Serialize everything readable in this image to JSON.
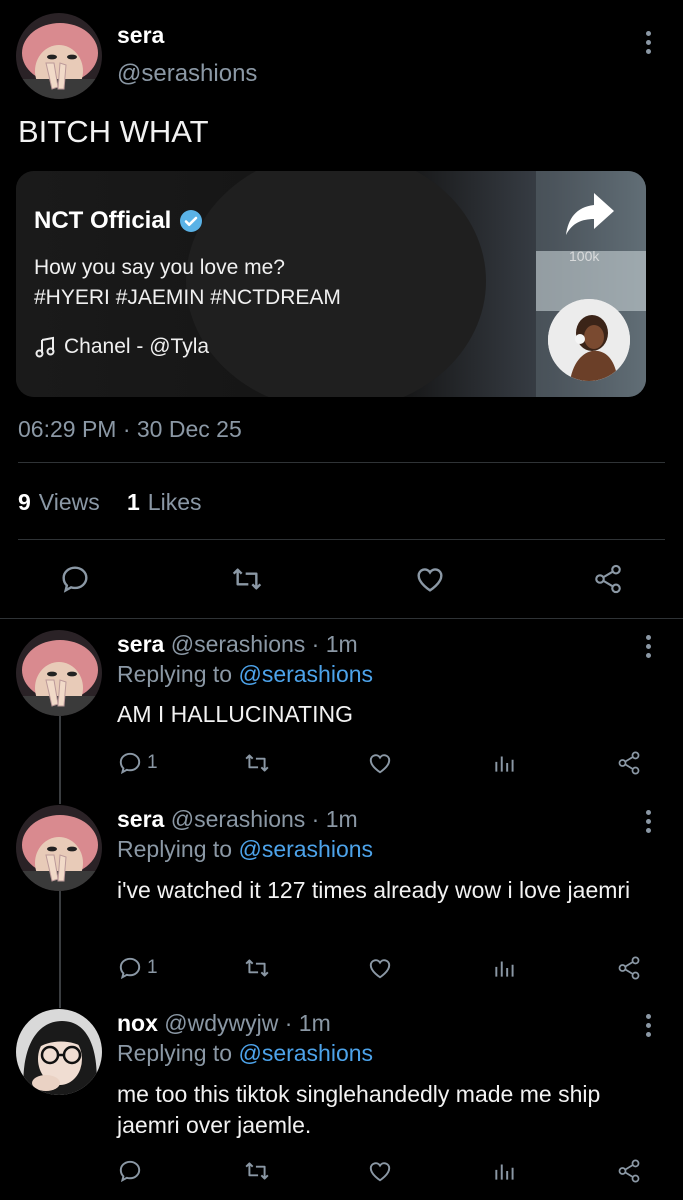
{
  "main_tweet": {
    "author_name": "sera",
    "author_handle": "@serashions",
    "text": "BITCH WHAT",
    "embed": {
      "account_name": "NCT Official",
      "caption_line1": "How you say you love me?",
      "caption_line2": "#HYERI #JAEMIN #NCTDREAM",
      "music": "Chanel - @Tyla",
      "share_count": "100k"
    },
    "timestamp": "06:29 PM · 30 Dec 25",
    "views_count": "9",
    "views_label": "Views",
    "likes_count": "1",
    "likes_label": "Likes"
  },
  "replies": [
    {
      "author_name": "sera",
      "meta": "@serashions · 1m",
      "replying_prefix": "Replying to",
      "replying_handle": "@serashions",
      "text": "AM I HALLUCINATING",
      "reply_count": "1"
    },
    {
      "author_name": "sera",
      "meta": "@serashions · 1m",
      "replying_prefix": "Replying to",
      "replying_handle": "@serashions",
      "text": "i've watched it 127 times already wow i love jaemri",
      "reply_count": "1"
    },
    {
      "author_name": "nox",
      "meta": "@wdywyjw · 1m",
      "replying_prefix": "Replying to",
      "replying_handle": "@serashions",
      "text": "me too this tiktok singlehandedly made me ship jaemri over jaemle.",
      "reply_count": ""
    }
  ],
  "icons": {
    "reply": "reply-icon",
    "retweet": "retweet-icon",
    "like": "heart-icon",
    "views": "analytics-icon",
    "share": "share-icon",
    "more": "more-icon",
    "verified": "verified-badge-icon",
    "music": "music-note-icon"
  },
  "colors": {
    "background": "#000000",
    "text": "#e7e9ea",
    "muted": "#8b98a5",
    "link": "#4da3ea",
    "verified": "#1d9bf0"
  }
}
